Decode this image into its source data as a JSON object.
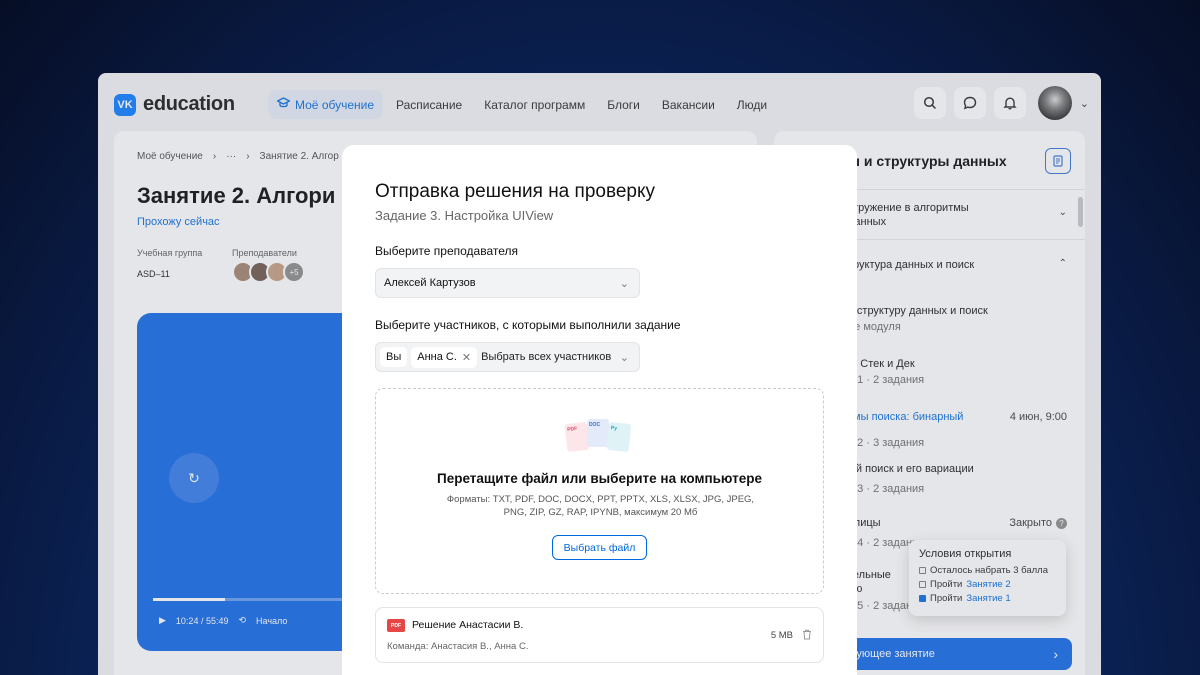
{
  "app": {
    "logo_mark": "VK",
    "logo_text": "education",
    "nav": [
      {
        "label": "Моё обучение",
        "active": true
      },
      {
        "label": "Расписание"
      },
      {
        "label": "Каталог программ"
      },
      {
        "label": "Блоги"
      },
      {
        "label": "Вакансии"
      },
      {
        "label": "Люди"
      }
    ],
    "icons": [
      "search-icon",
      "chat-icon",
      "bell-icon"
    ]
  },
  "lesson": {
    "breadcrumb": [
      "Моё обучение",
      "›",
      "···",
      "›",
      "Занятие 2. Алгор"
    ],
    "title": "Занятие 2. Алгори",
    "status": "Прохожу сейчас",
    "group_label": "Учебная группа",
    "group_value": "ASD–11",
    "teachers_label": "Преподаватели",
    "teachers_more": "+5",
    "video": {
      "time": "10:24 / 55:49",
      "start_label": "Начало",
      "progress": 0.12
    }
  },
  "course_panel": {
    "title": "ы и структуры данных",
    "items": [
      {
        "text": "огружение в алгоритмы",
        "text2": "данных",
        "collapsed": true
      },
      {
        "text": "труктура данных и поиск",
        "expanded": true
      },
      {
        "text": "в структуру данных и поиск",
        "sub": "ие модуля"
      },
      {
        "text": "и. Стек и Дек",
        "sub": "е 1 · 2 задания"
      },
      {
        "text": "тмы поиска: бинарный",
        "right": "4 июн, 9:00",
        "blue": true,
        "sub": "е 2 · 3 задания"
      },
      {
        "text": "ый поиск и его вариации",
        "sub": "е 3 · 2 задания"
      },
      {
        "text": "блицы",
        "right": "Закрыто",
        "sub": "е 4 · 2 задания"
      },
      {
        "text": "тельные",
        "text2": "ию",
        "sub": "е 5 · 2 задания"
      }
    ],
    "next_button": "дующее занятие",
    "tooltip": {
      "title": "Условия открытия",
      "rows": [
        {
          "text": "Осталось набрать 3 балла",
          "checked": false
        },
        {
          "text": "Пройти",
          "link": "Занятие 2",
          "checked": false
        },
        {
          "text": "Пройти",
          "link": "Занятие 1",
          "checked": true
        }
      ]
    }
  },
  "modal": {
    "title": "Отправка решения на проверку",
    "subtitle": "Задание 3. Настройка UIView",
    "teacher_label": "Выберите преподавателя",
    "teacher_value": "Алексей Картузов",
    "participants_label": "Выберите участников, с которыми выполнили задание",
    "chips": [
      "Вы",
      "Анна С."
    ],
    "select_all": "Выбрать всех участников",
    "dropzone": {
      "icons": [
        "PDF",
        "DOC",
        "Py"
      ],
      "title": "Перетащите файл или выберите на компьютере",
      "formats": "Форматы: TXT, PDF, DOC, DOCX, PPT, PPTX, XLS, XLSX, JPG, JPEG, PNG, ZIP, GZ, RAP, IPYNB, максимум 20 Мб",
      "button": "Выбрать файл"
    },
    "file": {
      "badge": "PDF",
      "name": "Решение Анастасии В.",
      "team": "Команда: Анастасия В., Анна С.",
      "size": "5 MB"
    }
  }
}
